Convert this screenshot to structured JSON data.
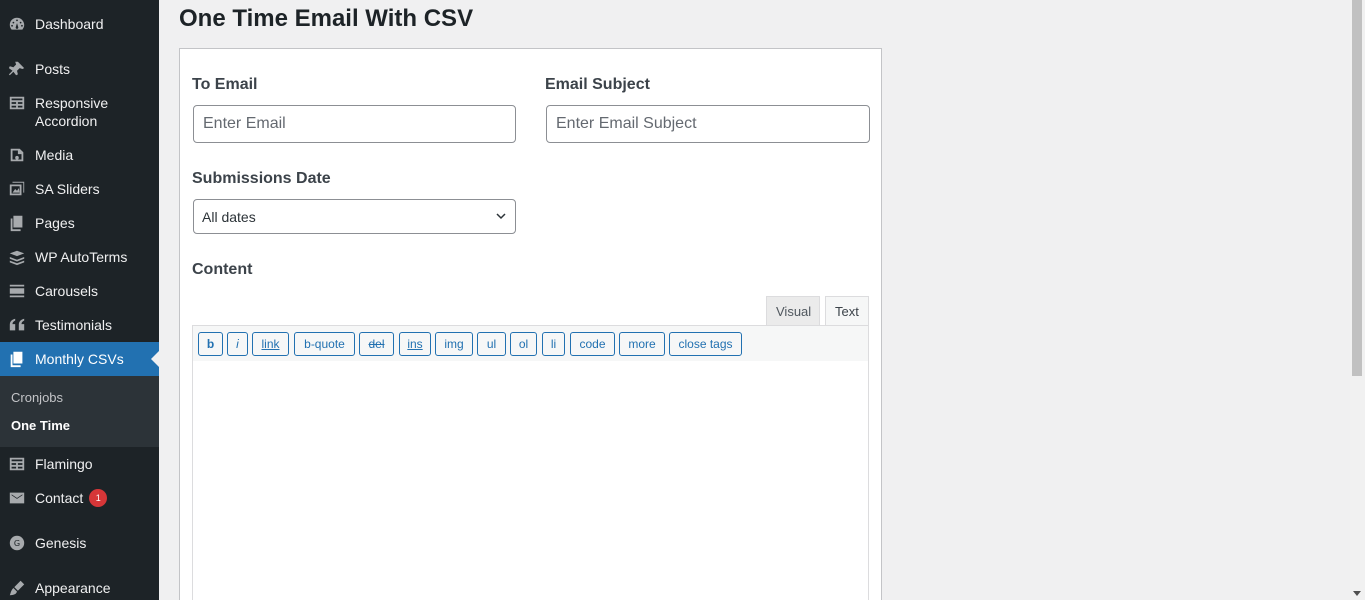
{
  "sidebar": {
    "items": [
      {
        "label": "Dashboard",
        "icon": "dashboard-icon"
      },
      {
        "label": "Posts",
        "icon": "pin-icon"
      },
      {
        "label": "Responsive Accordion",
        "icon": "list-icon"
      },
      {
        "label": "Media",
        "icon": "media-icon"
      },
      {
        "label": "SA Sliders",
        "icon": "slides-icon"
      },
      {
        "label": "Pages",
        "icon": "pages-icon"
      },
      {
        "label": "WP AutoTerms",
        "icon": "autoterms-icon"
      },
      {
        "label": "Carousels",
        "icon": "carousel-icon"
      },
      {
        "label": "Testimonials",
        "icon": "quote-icon"
      },
      {
        "label": "Monthly CSVs",
        "icon": "pages-icon"
      },
      {
        "label": "Flamingo",
        "icon": "list-icon"
      },
      {
        "label": "Contact",
        "icon": "mail-icon",
        "badge": "1"
      },
      {
        "label": "Genesis",
        "icon": "genesis-icon"
      },
      {
        "label": "Appearance",
        "icon": "brush-icon"
      }
    ],
    "submenu": [
      {
        "label": "Cronjobs"
      },
      {
        "label": "One Time"
      }
    ]
  },
  "page": {
    "title": "One Time Email With CSV"
  },
  "form": {
    "to_email_label": "To Email",
    "to_email_placeholder": "Enter Email",
    "subject_label": "Email Subject",
    "subject_placeholder": "Enter Email Subject",
    "date_label": "Submissions Date",
    "date_value": "All dates",
    "content_label": "Content"
  },
  "editor": {
    "tabs": [
      "Visual",
      "Text"
    ],
    "buttons": [
      "b",
      "i",
      "link",
      "b-quote",
      "del",
      "ins",
      "img",
      "ul",
      "ol",
      "li",
      "code",
      "more",
      "close tags"
    ]
  },
  "colors": {
    "sidebar_bg": "#1d2327",
    "accent": "#2271b1",
    "badge": "#d63638"
  }
}
